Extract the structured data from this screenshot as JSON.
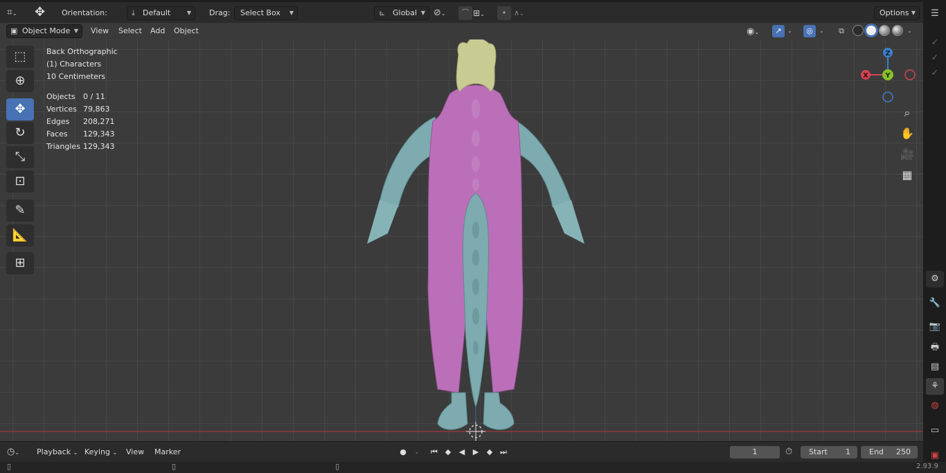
{
  "header": {
    "orientation_label": "Orientation:",
    "orientation_value": "Default",
    "drag_label": "Drag:",
    "drag_value": "Select Box",
    "transform_value": "Global",
    "options_label": "Options"
  },
  "viewheader": {
    "mode": "Object Mode",
    "menus": [
      "View",
      "Select",
      "Add",
      "Object"
    ]
  },
  "overlay": {
    "view": "Back Orthographic",
    "collection": "(1) Characters",
    "scale": "10 Centimeters",
    "stats": [
      {
        "k": "Objects",
        "v": "0 / 11"
      },
      {
        "k": "Vertices",
        "v": "79,863"
      },
      {
        "k": "Edges",
        "v": "208,271"
      },
      {
        "k": "Faces",
        "v": "129,343"
      },
      {
        "k": "Triangles",
        "v": "129,343"
      }
    ]
  },
  "gizmo": {
    "x": "X",
    "y": "Y",
    "z": "Z"
  },
  "colors": {
    "hair": "#c9cc92",
    "suit": "#bb6fb9",
    "skin": "#7dabaf",
    "active": "#4772b3",
    "redline": "#8f3a3a"
  },
  "timeline": {
    "menus": [
      "Playback",
      "Keying",
      "View",
      "Marker"
    ],
    "current_frame": "1",
    "start_label": "Start",
    "start": "1",
    "end_label": "End",
    "end": "250"
  },
  "status": {
    "version": "2.93.9"
  }
}
